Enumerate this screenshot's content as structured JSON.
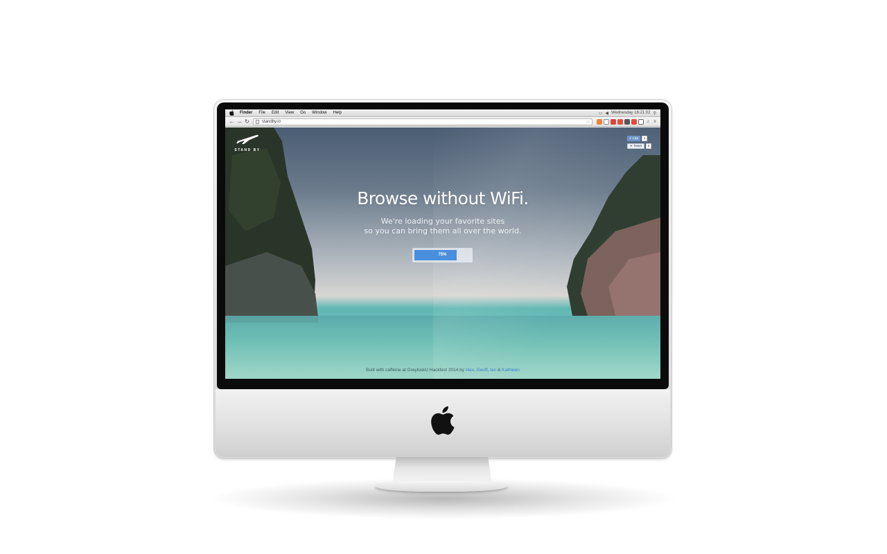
{
  "menubar": {
    "items": [
      "Finder",
      "File",
      "Edit",
      "View",
      "Go",
      "Window",
      "Help"
    ],
    "clock": "Wednesday 16:21:02"
  },
  "browser": {
    "url": "standby.io"
  },
  "page": {
    "logo_text": "STAND BY",
    "social": {
      "like_label": "Like",
      "like_count": "1",
      "tweet_label": "Tweet",
      "tweet_count": "0"
    },
    "headline": "Browse without WiFi.",
    "subline_1": "We're loading your favorite sites",
    "subline_2": "so you can bring them all over the world.",
    "progress": {
      "value": 0.75,
      "label": "75%"
    },
    "footer": {
      "prefix": "Built with caffeine at GreylockU Hackfest 2014 by",
      "names": [
        "Alex",
        "Geoff",
        "Ian",
        "Kathleen"
      ],
      "sep_comma": ",",
      "sep_and": "&"
    }
  },
  "colors": {
    "progress_fill": "#4a8fdd",
    "link": "#3a7bd5",
    "sky_top": "#4b5d73",
    "sea": "#5fb7b3"
  }
}
